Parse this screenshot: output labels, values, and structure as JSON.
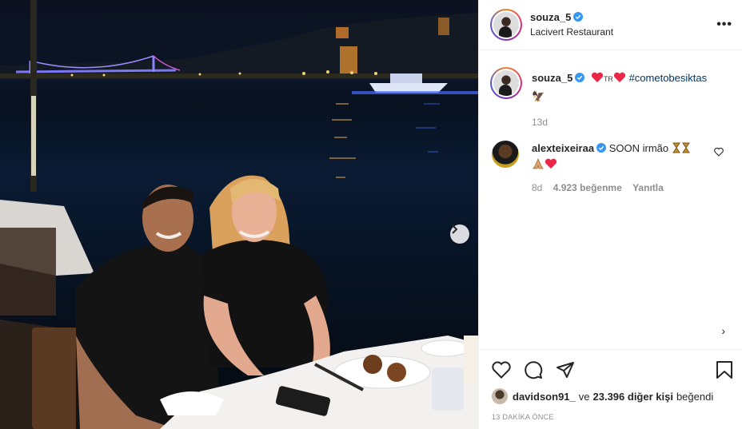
{
  "post": {
    "username": "souza_5",
    "location": "Lacivert Restaurant"
  },
  "caption": {
    "username": "souza_5",
    "flag_text": "TR",
    "hashtag": "#cometobesiktas",
    "emoji": "🦅",
    "age": "13d"
  },
  "comment": {
    "username": "alexteixeiraa",
    "text": "SOON irmão",
    "age": "8d",
    "likes": "4.923 beğenme",
    "reply_label": "Yanıtla"
  },
  "footer": {
    "liked_by_user": "davidson91_",
    "liked_by_middle": "ve",
    "liked_by_count": "23.396 diğer kişi",
    "liked_by_suffix": "beğendi",
    "timestamp": "13 DAKİKA ÖNCE",
    "caret": "›"
  },
  "colors": {
    "heart_red": "#ed2647",
    "verified_blue": "#3897f0",
    "link": "#00376b"
  }
}
